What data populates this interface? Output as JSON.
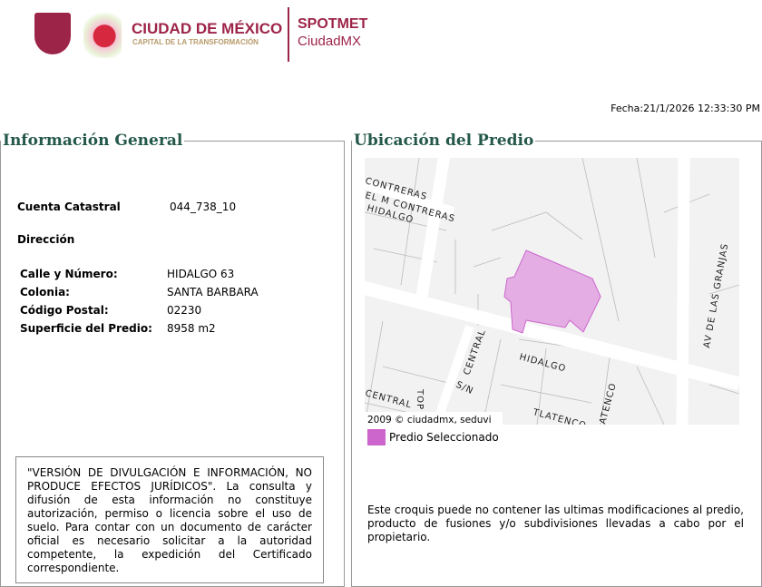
{
  "header": {
    "logo_title": "CIUDAD DE MÉXICO",
    "logo_subtitle": "CAPITAL DE LA TRANSFORMACIÓN",
    "app_title": "SPOTMET",
    "app_subtitle": "CiudadMX",
    "fecha": "Fecha:21/1/2026 12:33:30 PM"
  },
  "general": {
    "legend": "Información General",
    "cuenta_label": "Cuenta Catastral",
    "cuenta_value": "044_738_10",
    "direccion_label": "Dirección",
    "fields": [
      {
        "label": "Calle y Número:",
        "value": "HIDALGO 63"
      },
      {
        "label": "Colonia:",
        "value": "SANTA BARBARA"
      },
      {
        "label": "Código Postal:",
        "value": "02230"
      },
      {
        "label": "Superficie del Predio:",
        "value": "8958 m2"
      }
    ],
    "disclaimer": "\"VERSIÓN DE DIVULGACIÓN E INFORMACIÓN, NO PRODUCE EFECTOS JURÍDICOS\". La consulta y difusión de esta información no constituye autorización, permiso o licencia sobre el uso de suelo. Para contar con un documento de carácter oficial es necesario solicitar a la autoridad competente, la expedición del Certificado correspondiente."
  },
  "ubicacion": {
    "legend": "Ubicación del Predio",
    "map_labels": [
      "CONTRERAS",
      "EL M CONTRERAS",
      "HIDALGO",
      "HIDALGO",
      "AV DE LAS GRANJAS",
      "CENTRAL",
      "S/N",
      "CENTRAL",
      "TOP",
      "TLATENCO",
      "ATENCO"
    ],
    "copyright": "2009 © ciudadmx, seduvi",
    "legend_item": "Predio Seleccionado",
    "legend_color": "#cc66cc",
    "note": "Este croquis puede no contener las ultimas modificaciones al predio, producto de fusiones y/o subdivisiones llevadas a cabo por el propietario."
  }
}
